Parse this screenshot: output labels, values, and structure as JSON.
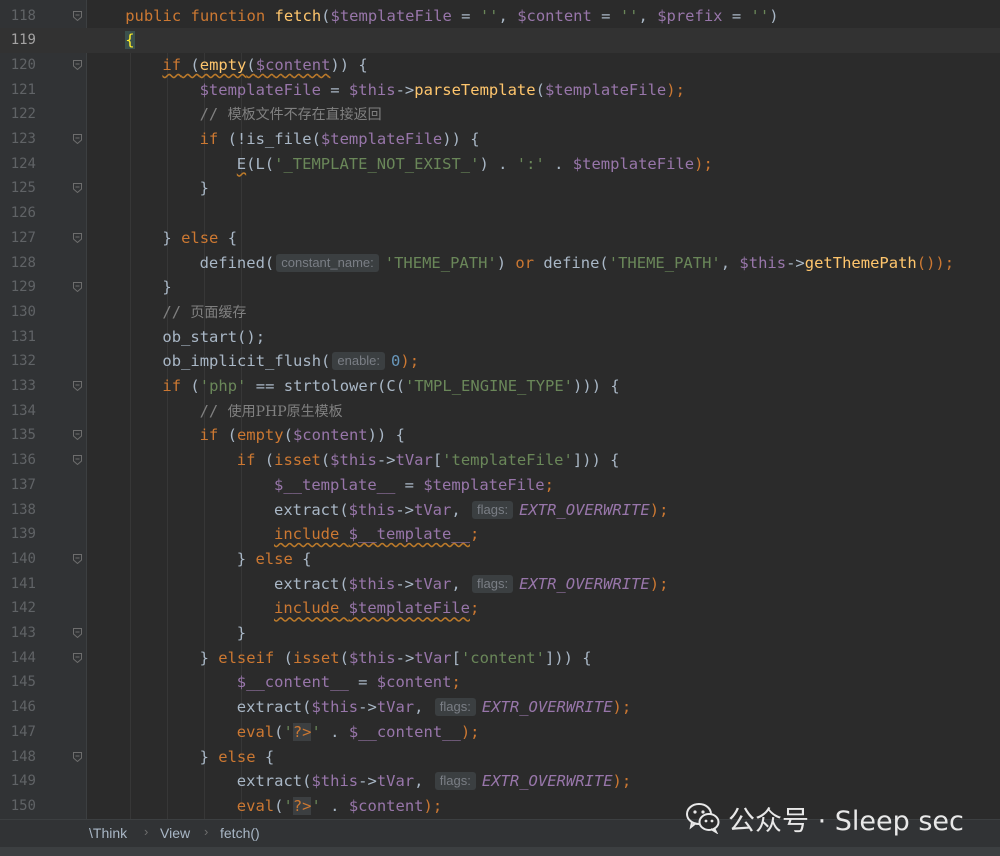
{
  "editor": {
    "current_line": 119,
    "lines": [
      {
        "n": "118",
        "fold": true
      },
      {
        "n": "119",
        "fold": false
      },
      {
        "n": "120",
        "fold": true
      },
      {
        "n": "121",
        "fold": false
      },
      {
        "n": "122",
        "fold": false
      },
      {
        "n": "123",
        "fold": true
      },
      {
        "n": "124",
        "fold": false
      },
      {
        "n": "125",
        "fold": true
      },
      {
        "n": "126",
        "fold": false
      },
      {
        "n": "127",
        "fold": true
      },
      {
        "n": "128",
        "fold": false
      },
      {
        "n": "129",
        "fold": true
      },
      {
        "n": "130",
        "fold": false
      },
      {
        "n": "131",
        "fold": false
      },
      {
        "n": "132",
        "fold": false
      },
      {
        "n": "133",
        "fold": true
      },
      {
        "n": "134",
        "fold": false
      },
      {
        "n": "135",
        "fold": true
      },
      {
        "n": "136",
        "fold": true
      },
      {
        "n": "137",
        "fold": false
      },
      {
        "n": "138",
        "fold": false
      },
      {
        "n": "139",
        "fold": false
      },
      {
        "n": "140",
        "fold": true
      },
      {
        "n": "141",
        "fold": false
      },
      {
        "n": "142",
        "fold": false
      },
      {
        "n": "143",
        "fold": true
      },
      {
        "n": "144",
        "fold": true
      },
      {
        "n": "145",
        "fold": false
      },
      {
        "n": "146",
        "fold": false
      },
      {
        "n": "147",
        "fold": false
      },
      {
        "n": "148",
        "fold": true
      },
      {
        "n": "149",
        "fold": false
      },
      {
        "n": "150",
        "fold": false
      }
    ],
    "code": {
      "l118": {
        "kw1": "public function ",
        "fn": "fetch",
        "p1": "(",
        "v1": "$templateFile",
        "p2": " = ",
        "s1": "''",
        "p3": ", ",
        "v2": "$content",
        "p4": " = ",
        "s2": "''",
        "p5": ", ",
        "v3": "$prefix",
        "p6": " = ",
        "s3": "''",
        "p7": ")"
      },
      "l119": {
        "brace": "{"
      },
      "l120": {
        "kw": "if",
        "p1": " (",
        "fn": "empty",
        "p2": "(",
        "v": "$content",
        "p3": ")) {"
      },
      "l121": {
        "v1": "$templateFile",
        "p1": " = ",
        "v2": "$this",
        "p2": "->",
        "fn": "parseTemplate",
        "p3": "(",
        "v3": "$templateFile",
        "p4": ");"
      },
      "l122": {
        "slash": "// ",
        "text": "模板文件不存在直接返回"
      },
      "l123": {
        "kw": "if",
        "p1": " (!is_file(",
        "v": "$templateFile",
        "p2": ")) {"
      },
      "l124": {
        "p1": "E",
        "p2": "(L(",
        "s1": "'_TEMPLATE_NOT_EXIST_'",
        "p3": ") . ",
        "s2": "':'",
        "p4": " . ",
        "v": "$templateFile",
        "p5": ");"
      },
      "l125": {
        "p1": "}"
      },
      "l126": {},
      "l127": {
        "p1": "} ",
        "kw": "else",
        "p2": " {"
      },
      "l128": {
        "p1": "defined(",
        "hint": "constant_name:",
        "s1": "'THEME_PATH'",
        "p2": ") ",
        "kw": "or",
        "p3": " define(",
        "s2": "'THEME_PATH'",
        "p4": ", ",
        "v": "$this",
        "p5": "->",
        "fn": "getThemePath",
        "p6": "());"
      },
      "l129": {
        "p1": "}"
      },
      "l130": {
        "slash": "// ",
        "text": "页面缓存"
      },
      "l131": {
        "p1": "ob_start();"
      },
      "l132": {
        "p1": "ob_implicit_flush(",
        "hint": "enable:",
        "num": "0",
        "p2": ");"
      },
      "l133": {
        "kw": "if",
        "p1": " (",
        "s1": "'php'",
        "p2": " == strtolower(C(",
        "s2": "'TMPL_ENGINE_TYPE'",
        "p3": "))) {"
      },
      "l134": {
        "slash": "// ",
        "text": "使用PHP原生模板"
      },
      "l135": {
        "kw": "if",
        "p1": " (",
        "fn": "empty",
        "p2": "(",
        "v": "$content",
        "p3": ")) {"
      },
      "l136": {
        "kw": "if",
        "p1": " (",
        "fn": "isset",
        "p2": "(",
        "v1": "$this",
        "p3": "->",
        "v2": "tVar",
        "p4": "[",
        "s": "'templateFile'",
        "p5": "])) {"
      },
      "l137": {
        "v1": "$__template__",
        "p1": " = ",
        "v2": "$templateFile",
        "p2": ";"
      },
      "l138": {
        "p1": "extract(",
        "v1": "$this",
        "p2": "->",
        "v2": "tVar",
        "p3": ", ",
        "hint": "flags:",
        "c": "EXTR_OVERWRITE",
        "p4": ");"
      },
      "l139": {
        "kw": "include ",
        "v": "$__template__",
        "p1": ";"
      },
      "l140": {
        "p1": "} ",
        "kw": "else",
        "p2": " {"
      },
      "l141": {
        "p1": "extract(",
        "v1": "$this",
        "p2": "->",
        "v2": "tVar",
        "p3": ", ",
        "hint": "flags:",
        "c": "EXTR_OVERWRITE",
        "p4": ");"
      },
      "l142": {
        "kw": "include ",
        "v": "$templateFile",
        "p1": ";"
      },
      "l143": {
        "p1": "}"
      },
      "l144": {
        "p1": "} ",
        "kw": "elseif",
        "p2": " (",
        "fn": "isset",
        "p3": "(",
        "v1": "$this",
        "p4": "->",
        "v2": "tVar",
        "p5": "[",
        "s": "'content'",
        "p6": "])) {"
      },
      "l145": {
        "v1": "$__content__",
        "p1": " = ",
        "v2": "$content",
        "p2": ";"
      },
      "l146": {
        "p1": "extract(",
        "v1": "$this",
        "p2": "->",
        "v2": "tVar",
        "p3": ", ",
        "hint": "flags:",
        "c": "EXTR_OVERWRITE",
        "p4": ");"
      },
      "l147": {
        "kw": "eval",
        "p1": "(",
        "s1": "'",
        "tag": "?>",
        "s2": "'",
        "p2": " . ",
        "v": "$__content__",
        "p3": ");"
      },
      "l148": {
        "p1": "} ",
        "kw": "else",
        "p2": " {"
      },
      "l149": {
        "p1": "extract(",
        "v1": "$this",
        "p2": "->",
        "v2": "tVar",
        "p3": ", ",
        "hint": "flags:",
        "c": "EXTR_OVERWRITE",
        "p4": ");"
      },
      "l150": {
        "kw": "eval",
        "p1": "(",
        "s1": "'",
        "tag": "?>",
        "s2": "'",
        "p2": " . ",
        "v": "$content",
        "p3": ");"
      }
    }
  },
  "breadcrumb": {
    "items": [
      "\\Think",
      "View",
      "fetch()"
    ],
    "separator": "›"
  },
  "watermark": {
    "text": "公众号 · Sleep sec"
  },
  "colors": {
    "background": "#2b2b2b",
    "keyword": "#cc7832",
    "variable": "#9876aa",
    "function": "#ffc66d",
    "string": "#6a8759",
    "comment": "#808080"
  }
}
